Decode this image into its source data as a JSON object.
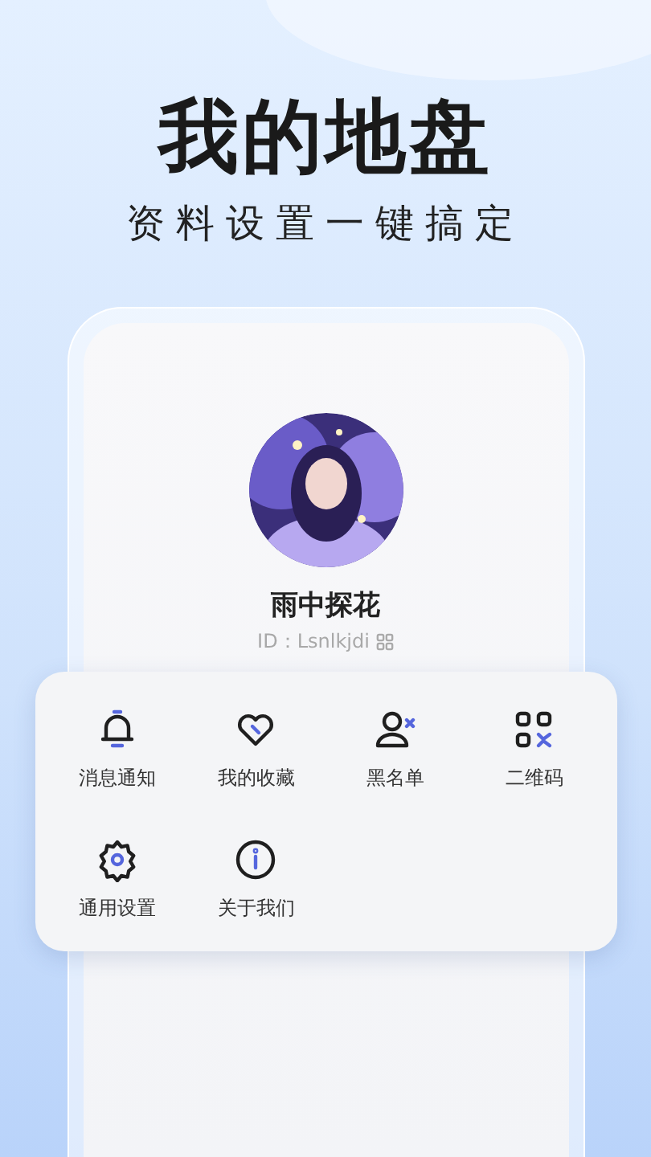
{
  "headline": "我的地盘",
  "subtitle": "资料设置一键搞定",
  "profile": {
    "name": "雨中探花",
    "id_label": "ID：Lsnlkjdi"
  },
  "menu": [
    {
      "kind": "bell",
      "label": "消息通知"
    },
    {
      "kind": "heart",
      "label": "我的收藏"
    },
    {
      "kind": "block-user",
      "label": "黑名单"
    },
    {
      "kind": "qr",
      "label": "二维码"
    },
    {
      "kind": "gear",
      "label": "通用设置"
    },
    {
      "kind": "info",
      "label": "关于我们"
    }
  ]
}
